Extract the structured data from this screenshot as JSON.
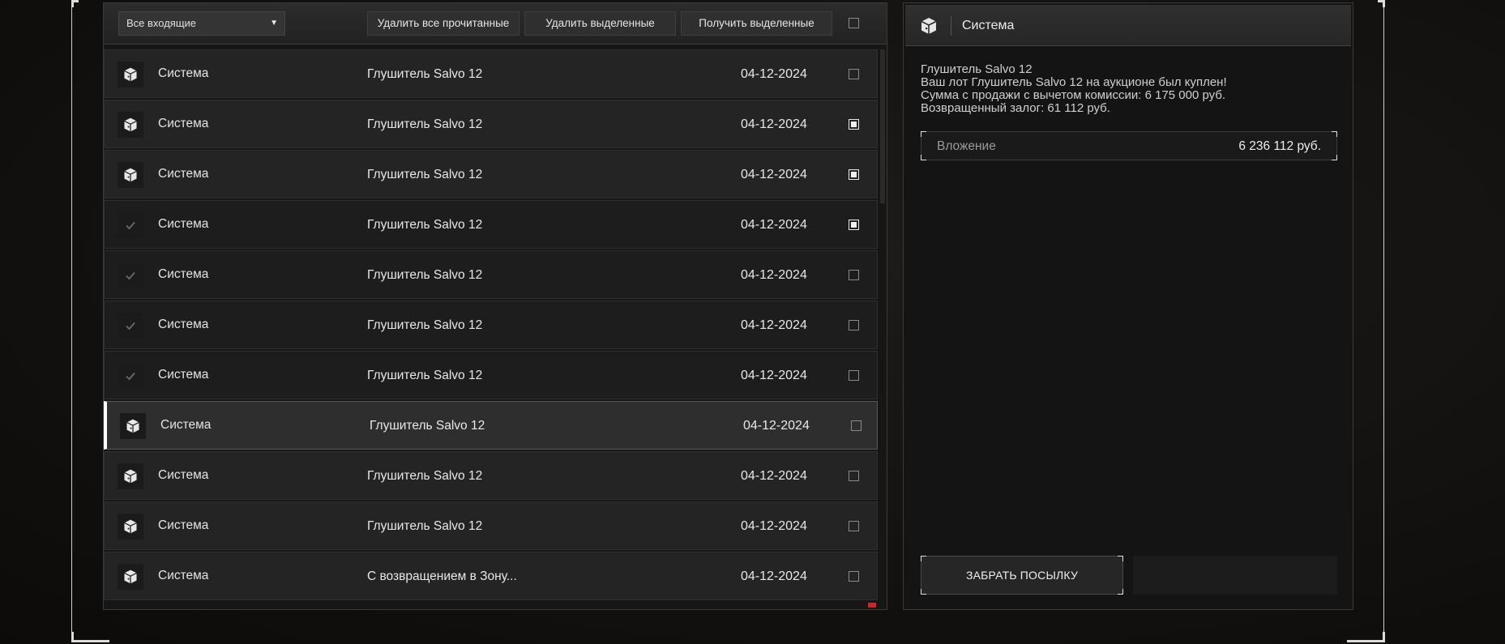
{
  "toolbar": {
    "filter_value": "Все входящие",
    "delete_read_label": "Удалить все прочитанные",
    "delete_selected_label": "Удалить выделенные",
    "receive_selected_label": "Получить выделенные",
    "select_all_checked": false
  },
  "messages": [
    {
      "sender": "Система",
      "subject": "Глушитель Salvo 12",
      "date": "04-12-2024",
      "icon": "package-icon",
      "read": false,
      "checked": false,
      "active": false
    },
    {
      "sender": "Система",
      "subject": "Глушитель Salvo 12",
      "date": "04-12-2024",
      "icon": "package-icon",
      "read": false,
      "checked": true,
      "active": false
    },
    {
      "sender": "Система",
      "subject": "Глушитель Salvo 12",
      "date": "04-12-2024",
      "icon": "package-icon",
      "read": false,
      "checked": true,
      "active": false
    },
    {
      "sender": "Система",
      "subject": "Глушитель Salvo 12",
      "date": "04-12-2024",
      "icon": "check-icon",
      "read": true,
      "checked": true,
      "active": false
    },
    {
      "sender": "Система",
      "subject": "Глушитель Salvo 12",
      "date": "04-12-2024",
      "icon": "check-icon",
      "read": true,
      "checked": false,
      "active": false
    },
    {
      "sender": "Система",
      "subject": "Глушитель Salvo 12",
      "date": "04-12-2024",
      "icon": "check-icon",
      "read": true,
      "checked": false,
      "active": false
    },
    {
      "sender": "Система",
      "subject": "Глушитель Salvo 12",
      "date": "04-12-2024",
      "icon": "check-icon",
      "read": true,
      "checked": false,
      "active": false
    },
    {
      "sender": "Система",
      "subject": "Глушитель Salvo 12",
      "date": "04-12-2024",
      "icon": "package-icon",
      "read": false,
      "checked": false,
      "active": true
    },
    {
      "sender": "Система",
      "subject": "Глушитель Salvo 12",
      "date": "04-12-2024",
      "icon": "package-icon",
      "read": false,
      "checked": false,
      "active": false
    },
    {
      "sender": "Система",
      "subject": "Глушитель Salvo 12",
      "date": "04-12-2024",
      "icon": "package-icon",
      "read": false,
      "checked": false,
      "active": false
    },
    {
      "sender": "Система",
      "subject": "С возвращением в Зону...",
      "date": "04-12-2024",
      "icon": "package-icon",
      "read": false,
      "checked": false,
      "active": false
    }
  ],
  "detail": {
    "sender": "Система",
    "body_lines": [
      "Глушитель Salvo 12",
      "Ваш лот Глушитель Salvo 12 на аукционе был куплен!",
      "Сумма с продажи с вычетом комиссии: 6 175 000 руб.",
      "Возвращенный залог: 61 112 руб."
    ],
    "attachment_label": "Вложение",
    "attachment_value": "6 236 112 руб.",
    "claim_button_label": "ЗАБРАТЬ ПОСЫЛКУ"
  },
  "colors": {
    "background": "#141210",
    "panel": "#161616",
    "row": "#242424",
    "row_read": "#1d1d1d",
    "active_accent": "#ffffff",
    "scroll_marker": "#c42a2a"
  }
}
